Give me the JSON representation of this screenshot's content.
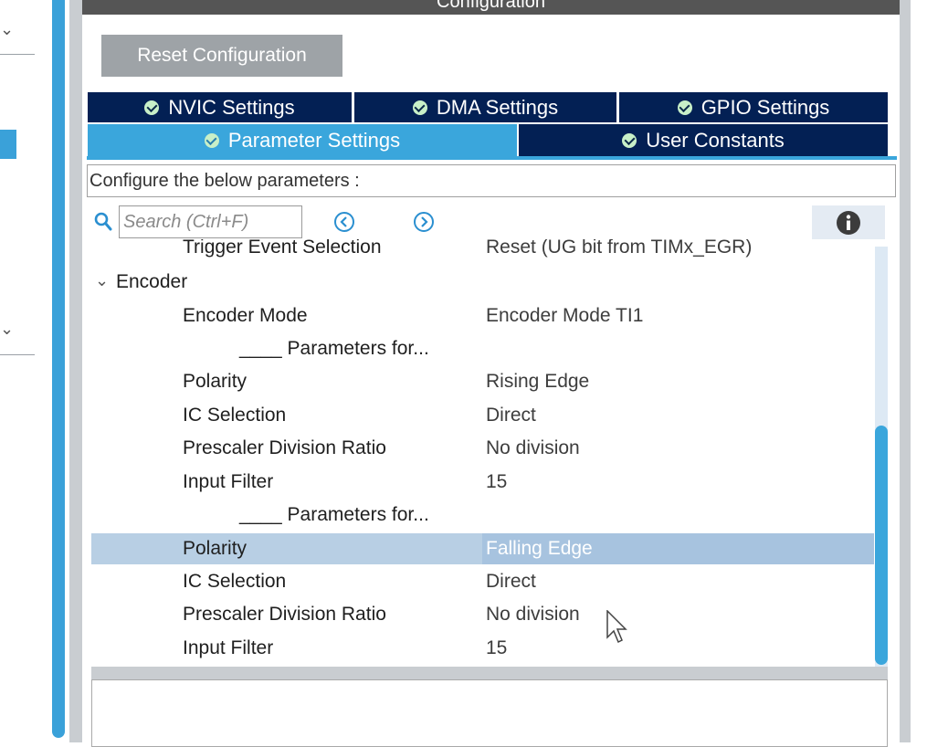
{
  "panel": {
    "title": "Configuration",
    "reset_button": "Reset Configuration"
  },
  "tabs": {
    "row1": [
      {
        "label": "NVIC Settings",
        "icon": "check-circle-icon"
      },
      {
        "label": "DMA Settings",
        "icon": "check-circle-icon"
      },
      {
        "label": "GPIO Settings",
        "icon": "check-circle-icon"
      }
    ],
    "row2": [
      {
        "label": "Parameter Settings",
        "icon": "check-circle-icon",
        "active": true
      },
      {
        "label": "User Constants",
        "icon": "check-circle-icon",
        "active": false
      }
    ]
  },
  "description": "Configure the below parameters :",
  "search": {
    "placeholder": "Search (Ctrl+F)"
  },
  "params": {
    "clipped_row": {
      "name": "Trigger Event Selection",
      "value": "Reset (UG bit from TIMx_EGR)"
    },
    "group": "Encoder",
    "rows": [
      {
        "name": "Encoder Mode",
        "value": "Encoder Mode TI1"
      },
      {
        "name": "____ Parameters for...",
        "value": ""
      },
      {
        "name": "Polarity",
        "value": "Rising Edge"
      },
      {
        "name": "IC Selection",
        "value": "Direct"
      },
      {
        "name": "Prescaler Division Ratio",
        "value": "No division"
      },
      {
        "name": "Input Filter",
        "value": "15"
      },
      {
        "name": "____ Parameters for...",
        "value": ""
      },
      {
        "name": "Polarity",
        "value": "Falling Edge"
      },
      {
        "name": "IC Selection",
        "value": "Direct"
      },
      {
        "name": "Prescaler Division Ratio",
        "value": "No division"
      },
      {
        "name": "Input Filter",
        "value": "15"
      }
    ]
  },
  "colors": {
    "tab_dark": "#032054",
    "tab_active": "#3aa6dc",
    "selected_row": "#b8cfe4",
    "title_bar": "#555555"
  }
}
